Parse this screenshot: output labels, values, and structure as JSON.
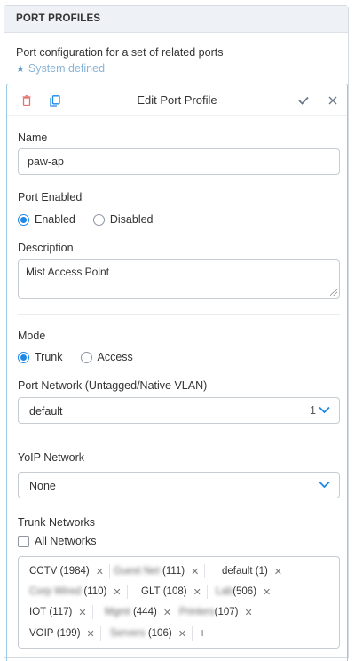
{
  "panel": {
    "title": "PORT PROFILES",
    "description": "Port configuration for a set of related ports",
    "system_defined": "System defined"
  },
  "edit": {
    "title": "Edit Port Profile",
    "name_label": "Name",
    "name_value": "paw-ap",
    "port_enabled_label": "Port Enabled",
    "enabled_label": "Enabled",
    "disabled_label": "Disabled",
    "enabled_selected": "Enabled",
    "description_label": "Description",
    "description_value": "Mist Access Point",
    "mode_label": "Mode",
    "trunk_label": "Trunk",
    "access_label": "Access",
    "mode_selected": "Trunk",
    "port_network_label": "Port Network (Untagged/Native VLAN)",
    "port_network_value": "default",
    "port_network_count": "1",
    "voip_label": "YoIP Network",
    "voip_value": "None",
    "trunk_networks_label": "Trunk Networks",
    "all_networks_label": "All Networks",
    "all_networks_checked": false,
    "trunk_tags": [
      {
        "label": "CCTV",
        "count": "(1984)",
        "blurred": false
      },
      {
        "label": "Guest Net",
        "count": "(111)",
        "blurred": true
      },
      {
        "label": "default",
        "count": "(1)",
        "blurred": false
      },
      {
        "label": "Corp Wired",
        "count": "(110)",
        "blurred": true
      },
      {
        "label": "GLT",
        "count": "(108)",
        "blurred": false
      },
      {
        "label": "Lab",
        "count": "(506)",
        "blurred": true
      },
      {
        "label": "IOT",
        "count": "(117)",
        "blurred": false
      },
      {
        "label": "Mgmt",
        "count": "(444)",
        "blurred": true
      },
      {
        "label": "Printers",
        "count": "(107)",
        "blurred": true
      },
      {
        "label": "VOIP",
        "count": "(199)",
        "blurred": false
      },
      {
        "label": "Servers",
        "count": "(106)",
        "blurred": true
      }
    ]
  },
  "colors": {
    "accent": "#1e88e5",
    "delete_icon": "#e57373",
    "header_bg": "#eef1f5",
    "edit_border": "#9cc8e8"
  },
  "icons": {
    "delete": "trash-icon",
    "copy": "copy-icon",
    "save": "checkmark-icon",
    "close": "close-icon",
    "system_defined": "star-icon"
  }
}
